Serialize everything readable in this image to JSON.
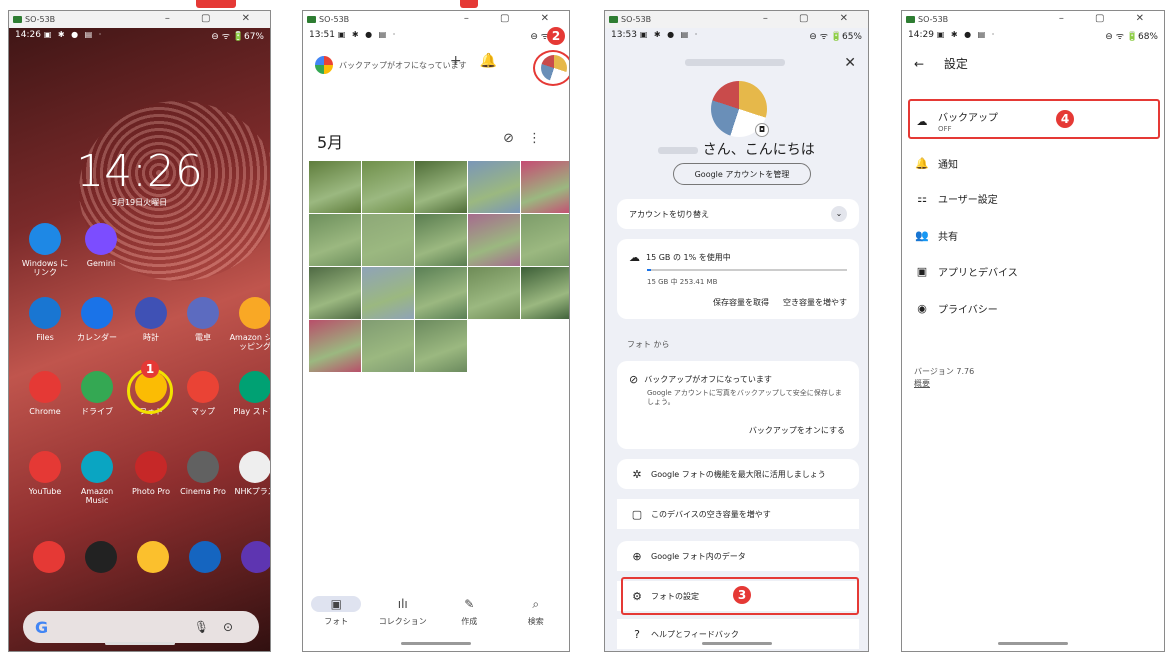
{
  "window": {
    "title": "SO-53B",
    "controls": "–  ▢  ✕"
  },
  "phone1": {
    "status_time": "14:26",
    "status_right": "⊖ ᯤ 🔋67%",
    "clock": "14:26",
    "date": "5月19日火曜日",
    "apps": [
      {
        "label": "Windows にリンク",
        "color": "#1e88e5"
      },
      {
        "label": "Gemini",
        "color": "#7c4dff"
      },
      {
        "label": "Files",
        "color": "#1976d2"
      },
      {
        "label": "カレンダー",
        "color": "#1a73e8"
      },
      {
        "label": "時計",
        "color": "#3f51b5"
      },
      {
        "label": "電卓",
        "color": "#5c6bc0"
      },
      {
        "label": "Amazon ショッピング",
        "color": "#f9a825"
      },
      {
        "label": "Chrome",
        "color": "#e53935"
      },
      {
        "label": "ドライブ",
        "color": "#34a853"
      },
      {
        "label": "フォト",
        "color": "#fbbc04"
      },
      {
        "label": "マップ",
        "color": "#ea4335"
      },
      {
        "label": "Play ストア",
        "color": "#00a173"
      },
      {
        "label": "YouTube",
        "color": "#e53935"
      },
      {
        "label": "Amazon Music",
        "color": "#0aa5c2"
      },
      {
        "label": "Photo Pro",
        "color": "#c62828"
      },
      {
        "label": "Cinema Pro",
        "color": "#616161"
      },
      {
        "label": "NHKプラス",
        "color": "#eeeeee"
      }
    ],
    "dock_icons": [
      {
        "name": "music-app-icon",
        "color": "#e53935"
      },
      {
        "name": "bravia-app-icon",
        "color": "#222222"
      },
      {
        "name": "smile-app-icon",
        "color": "#fbc02d"
      },
      {
        "name": "settings-app-icon",
        "color": "#1565c0"
      },
      {
        "name": "music-player-icon",
        "color": "#5e35b1"
      }
    ],
    "badge": "1"
  },
  "phone2": {
    "status_time": "13:51",
    "header_text": "バックアップがオフになっています",
    "month": "5月",
    "badge": "2",
    "nav": [
      {
        "icon": "▣",
        "label": "フォト"
      },
      {
        "icon": "ılı",
        "label": "コレクション"
      },
      {
        "icon": "✎",
        "label": "作成"
      },
      {
        "icon": "⌕",
        "label": "検索"
      }
    ],
    "photo_colors": [
      "#5f7d3c",
      "#6f8f4a",
      "#4f6d38",
      "#7a96b8",
      "#c64b73",
      "#6d8f5c",
      "#8da877",
      "#5a7d50",
      "#a66b8e",
      "#7d9c6a",
      "#4f6a44",
      "#8fa3b8",
      "#5a7f55",
      "#6e8b57",
      "#3d5f38",
      "#b84f6a",
      "#809c72",
      "#6b8a5e",
      "#709150",
      "#b04f7a"
    ]
  },
  "phone3": {
    "status_time": "13:53",
    "status_right": "⊖ ᯤ 🔋65%",
    "greeting": "さん、こんにちは",
    "manage_btn": "Google アカウントを管理",
    "switch_account": "アカウントを切り替え",
    "storage_title": "15 GB の 1% を使用中",
    "storage_detail": "15 GB 中 253.41 MB",
    "storage_get": "保存容量を取得",
    "storage_free": "空き容量を増やす",
    "storage_fraction": 0.02,
    "section_from": "フォト から",
    "backup_off_title": "バックアップがオフになっています",
    "backup_off_desc": "Google アカウントに写真をバックアップして安全に保存しましょう。",
    "backup_on_btn": "バックアップをオンにする",
    "menu": [
      {
        "icon": "✲",
        "label": "Google フォトの機能を最大限に活用しましょう"
      },
      {
        "icon": "▢",
        "label": "このデバイスの空き容量を増やす"
      },
      {
        "icon": "⊕",
        "label": "Google フォト内のデータ"
      },
      {
        "icon": "⚙",
        "label": "フォトの設定"
      },
      {
        "icon": "?",
        "label": "ヘルプとフィードバック"
      }
    ],
    "badge": "3"
  },
  "phone4": {
    "status_time": "14:29",
    "status_right": "⊖ ᯤ 🔋68%",
    "title": "設定",
    "backup_label": "バックアップ",
    "backup_sub": "OFF",
    "items": [
      {
        "icon": "🔔",
        "label": "通知"
      },
      {
        "icon": "⚏",
        "label": "ユーザー設定"
      },
      {
        "icon": "👥",
        "label": "共有"
      },
      {
        "icon": "▣",
        "label": "アプリとデバイス"
      },
      {
        "icon": "◉",
        "label": "プライバシー"
      }
    ],
    "version": "バージョン 7.76",
    "overview": "概要",
    "badge": "4"
  }
}
